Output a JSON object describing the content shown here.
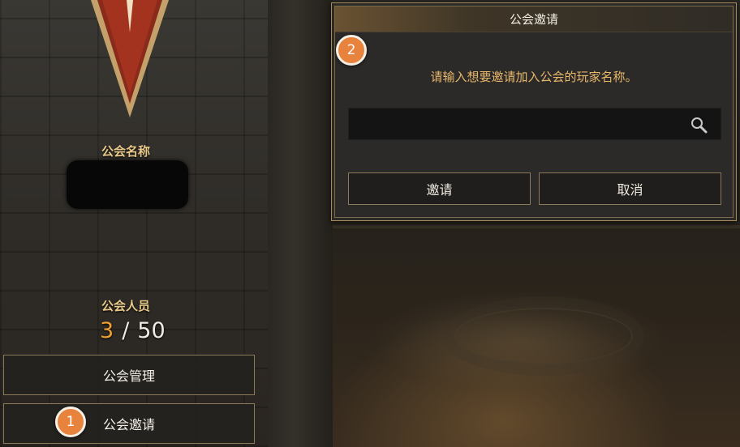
{
  "left_panel": {
    "guild_name_label": "公会名称",
    "guild_members_label": "公会人员",
    "member_count": {
      "current": "3",
      "separator": "/",
      "max": "50"
    },
    "buttons": {
      "manage": "公会管理",
      "invite": "公会邀请"
    }
  },
  "dialog": {
    "title": "公会邀请",
    "message": "请输入想要邀请加入公会的玩家名称。",
    "input": {
      "value": "",
      "placeholder": ""
    },
    "buttons": {
      "invite": "邀请",
      "cancel": "取消"
    }
  },
  "badges": {
    "step1": "1",
    "step2": "2"
  },
  "colors": {
    "accent": "#f0a032",
    "badge": "#e8833e",
    "label": "#e8c98a",
    "message": "#e8b76a"
  },
  "icons": {
    "search": "search-icon",
    "banner": "guild-banner-icon"
  }
}
